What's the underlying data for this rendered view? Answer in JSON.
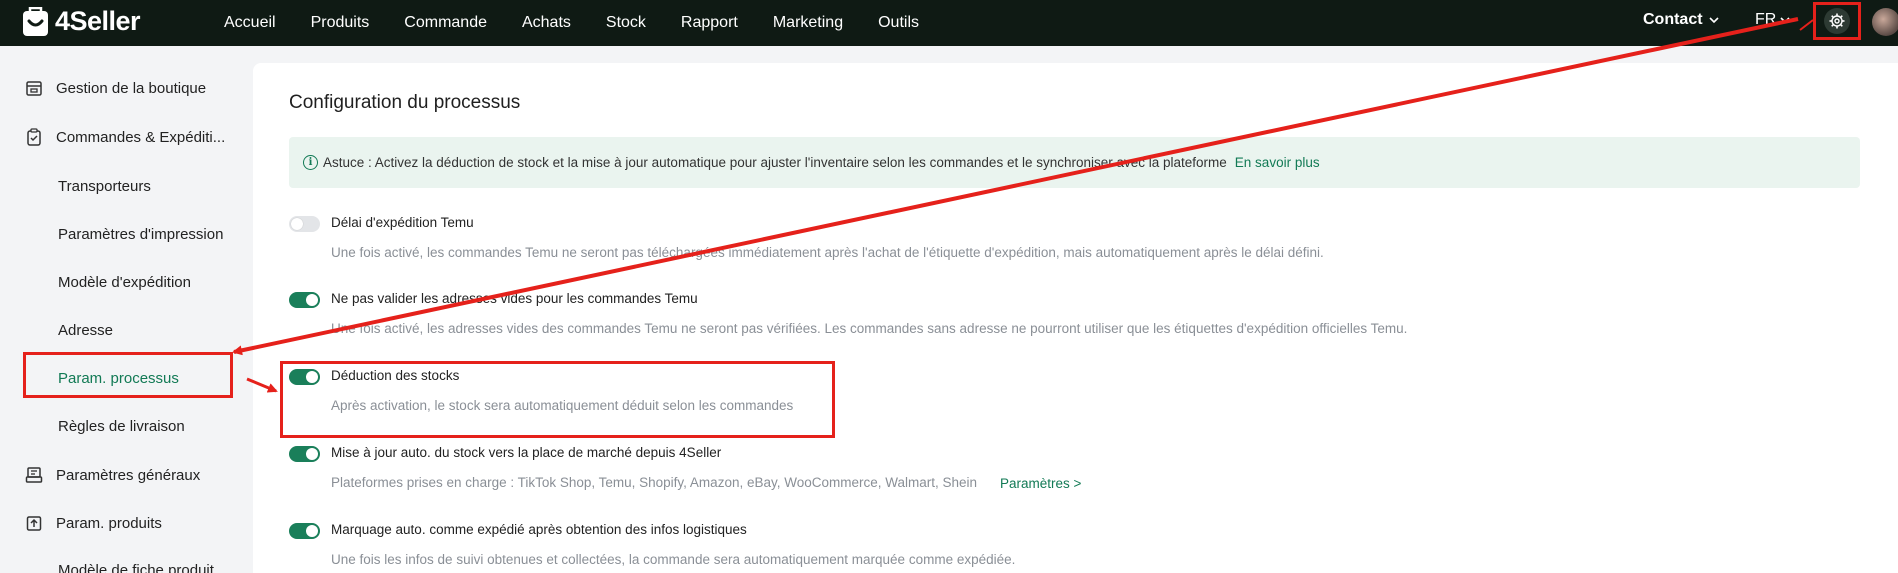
{
  "brand": {
    "name": "4Seller"
  },
  "nav": {
    "items": [
      "Accueil",
      "Produits",
      "Commande",
      "Achats",
      "Stock",
      "Rapport",
      "Marketing",
      "Outils"
    ]
  },
  "topbar": {
    "contact": "Contact",
    "lang": "FR"
  },
  "sidebar": {
    "items": [
      {
        "label": "Gestion de la boutique",
        "icon": "shop-icon"
      },
      {
        "label": "Commandes & Expéditi...",
        "icon": "clipboard-icon"
      },
      {
        "label": "Transporteurs"
      },
      {
        "label": "Paramètres d'impression"
      },
      {
        "label": "Modèle d'expédition"
      },
      {
        "label": "Adresse"
      },
      {
        "label": "Param. processus",
        "active": true
      },
      {
        "label": "Règles de livraison"
      },
      {
        "label": "Paramètres généraux",
        "icon": "printer-icon"
      },
      {
        "label": "Param. produits",
        "icon": "upload-box-icon"
      },
      {
        "label": "Modèle de fiche produit"
      }
    ]
  },
  "main": {
    "title": "Configuration du processus",
    "tip": {
      "text": "Astuce : Activez la déduction de stock et la mise à jour automatique pour ajuster l'inventaire selon les commandes et le synchroniser avec la plateforme",
      "link": "En savoir plus"
    },
    "options": [
      {
        "label": "Délai d'expédition Temu",
        "desc": "Une fois activé, les commandes Temu ne seront pas téléchargées immédiatement après l'achat de l'étiquette d'expédition, mais automatiquement après le délai défini.",
        "enabled": false
      },
      {
        "label": "Ne pas valider les adresses vides pour les commandes Temu",
        "desc": "Une fois activé, les adresses vides des commandes Temu ne seront pas vérifiées. Les commandes sans adresse ne pourront utiliser que les étiquettes d'expédition officielles Temu.",
        "enabled": true
      },
      {
        "label": "Déduction des stocks",
        "desc": "Après activation, le stock sera automatiquement déduit selon les commandes",
        "enabled": true
      },
      {
        "label": "Mise à jour auto. du stock vers la place de marché depuis 4Seller",
        "desc": "Plateformes prises en charge : TikTok Shop, Temu, Shopify, Amazon, eBay, WooCommerce, Walmart, Shein",
        "enabled": true
      },
      {
        "label": "Marquage auto. comme expédié après obtention des infos logistiques",
        "desc": "Une fois les infos de suivi obtenues et collectées, la commande sera automatiquement marquée comme expédiée.",
        "enabled": true
      }
    ],
    "params_link": "Paramètres >"
  },
  "colors": {
    "accent": "#127a55",
    "highlight": "#e5211b",
    "topbar": "#0f1a14"
  }
}
